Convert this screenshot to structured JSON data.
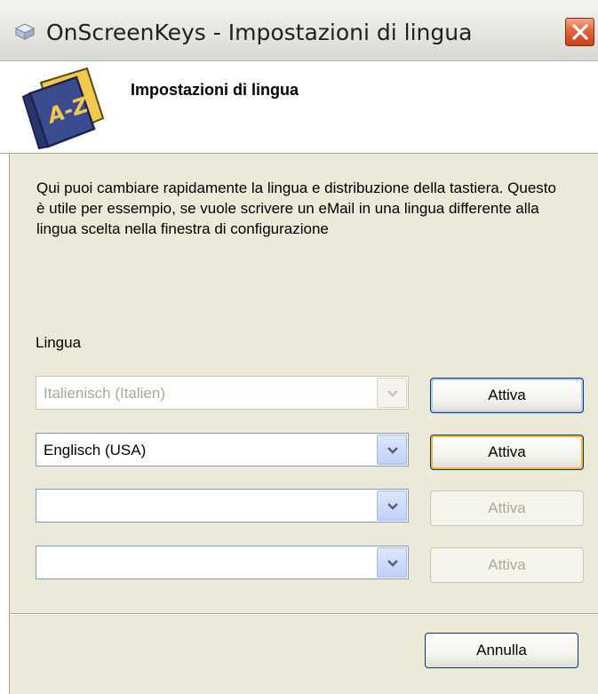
{
  "window": {
    "title": "OnScreenKeys - Impostazioni di lingua",
    "title_icon": "keyboard-key-icon",
    "close_icon": "close-icon"
  },
  "header": {
    "title": "Impostazioni di lingua",
    "icon": "book-a-z-icon",
    "icon_text": "A-Z"
  },
  "description": "Qui puoi cambiare rapidamente la lingua e distribuzione della tastiera. Questo è utile per essempio, se vuole scrivere un eMail in una lingua differente alla lingua scelta nella finestra di configurazione",
  "language_label": "Lingua",
  "rows": [
    {
      "value": "Italienisch (Italien)",
      "combo_enabled": false,
      "button_label": "Attiva",
      "button_enabled": true
    },
    {
      "value": "Englisch (USA)",
      "combo_enabled": true,
      "button_label": "Attiva",
      "button_enabled": true
    },
    {
      "value": "",
      "combo_enabled": true,
      "button_label": "Attiva",
      "button_enabled": false
    },
    {
      "value": "",
      "combo_enabled": true,
      "button_label": "Attiva",
      "button_enabled": false
    }
  ],
  "cancel_label": "Annulla",
  "colors": {
    "dialog_bg": "#ece9d8",
    "button_border": "#003c74",
    "close_button": "#e1633b"
  }
}
